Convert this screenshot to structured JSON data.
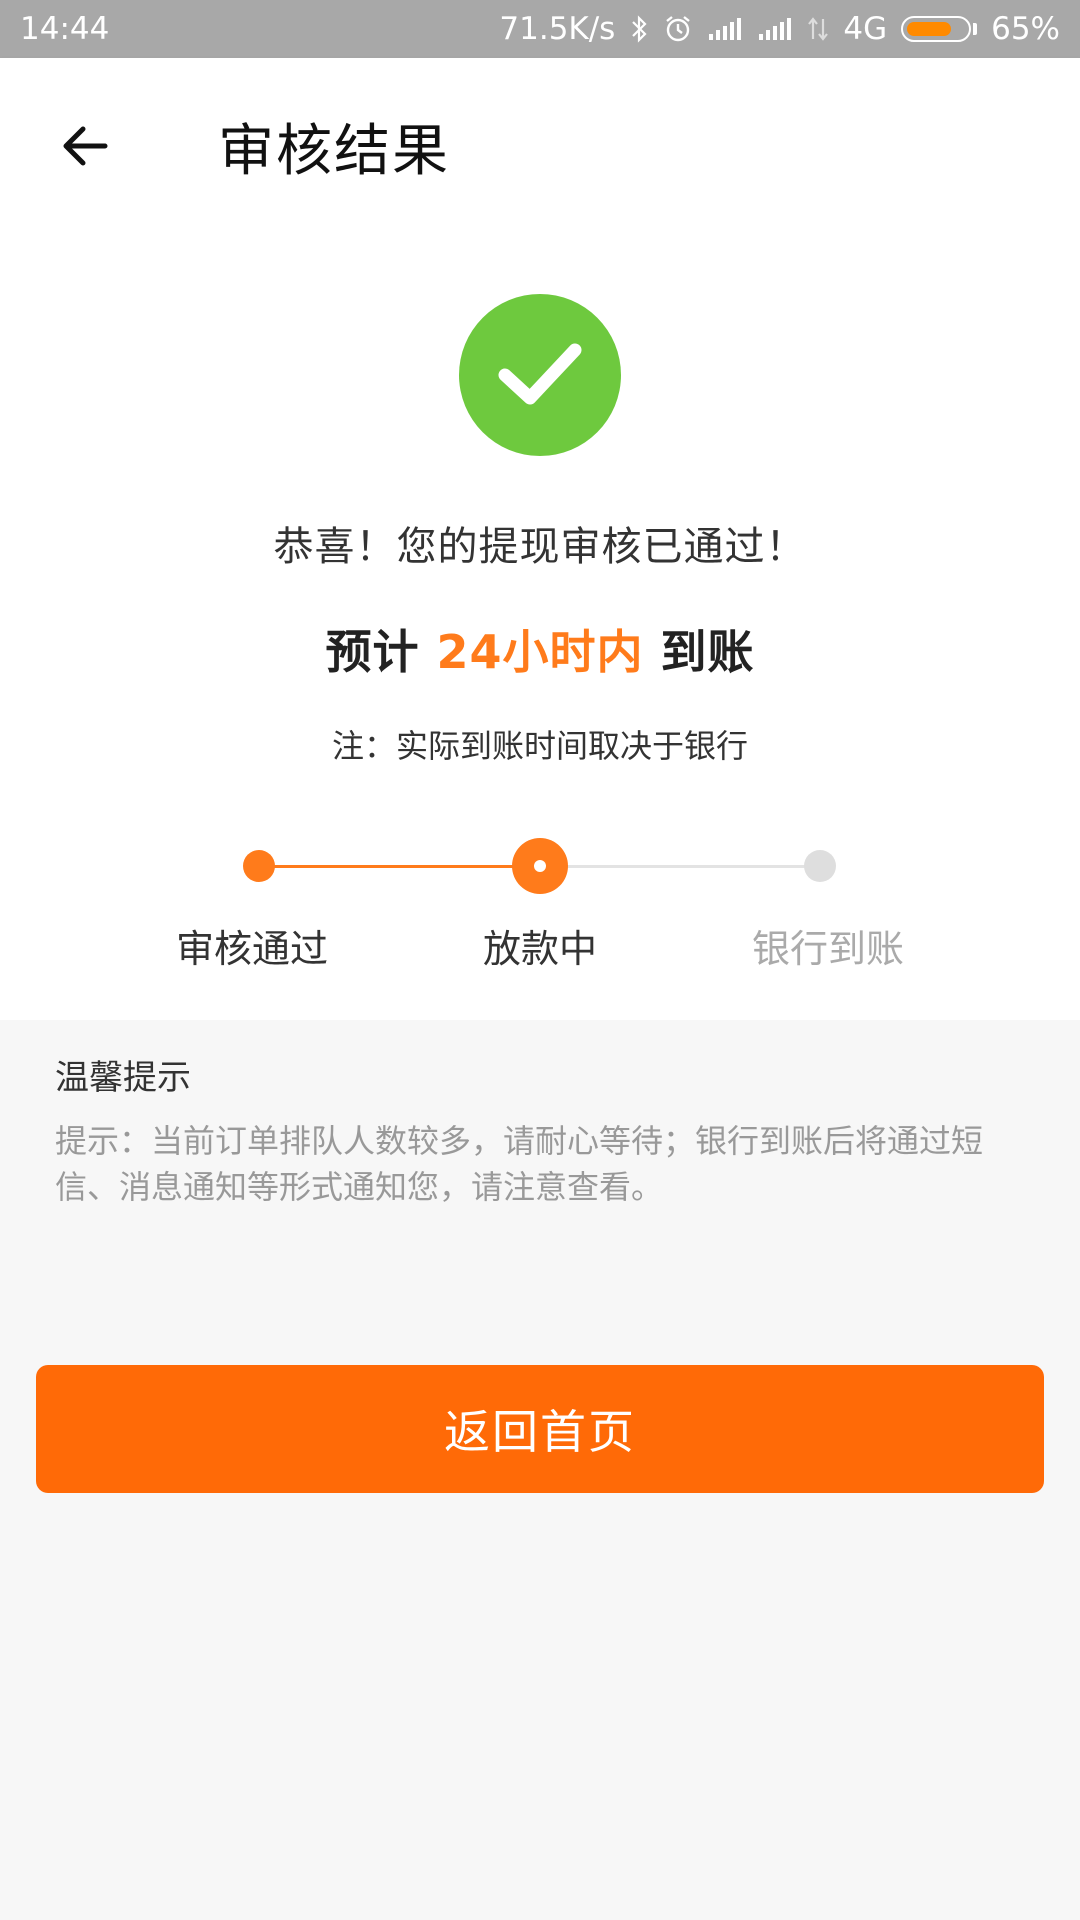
{
  "status_bar": {
    "time": "14:44",
    "net_speed": "71.5K/s",
    "network": "4G",
    "battery_pct": "65%",
    "battery_level": 0.65,
    "icons": [
      "bluetooth-icon",
      "alarm-icon",
      "signal-icon",
      "signal-icon",
      "data-arrows-icon",
      "battery-icon"
    ],
    "battery_color": "#ff8a00"
  },
  "header": {
    "title": "审核结果",
    "back_icon": "back-arrow-icon"
  },
  "result": {
    "icon": "check-circle-icon",
    "icon_color": "#6ec93e",
    "message": "恭喜！您的提现审核已通过！",
    "eta_prefix": "预计 ",
    "eta_highlight": "24小时内",
    "eta_suffix": " 到账",
    "note": "注：实际到账时间取决于银行"
  },
  "progress": {
    "steps": [
      {
        "label": "审核通过",
        "state": "done"
      },
      {
        "label": "放款中",
        "state": "current"
      },
      {
        "label": "银行到账",
        "state": "pending"
      }
    ],
    "accent_color": "#ff7b1b"
  },
  "tips": {
    "title": "温馨提示",
    "text": "提示：当前订单排队人数较多，请耐心等待；银行到账后将通过短信、消息通知等形式通知您，请注意查看。"
  },
  "actions": {
    "home_label": "返回首页",
    "button_color": "#ff6a07"
  }
}
